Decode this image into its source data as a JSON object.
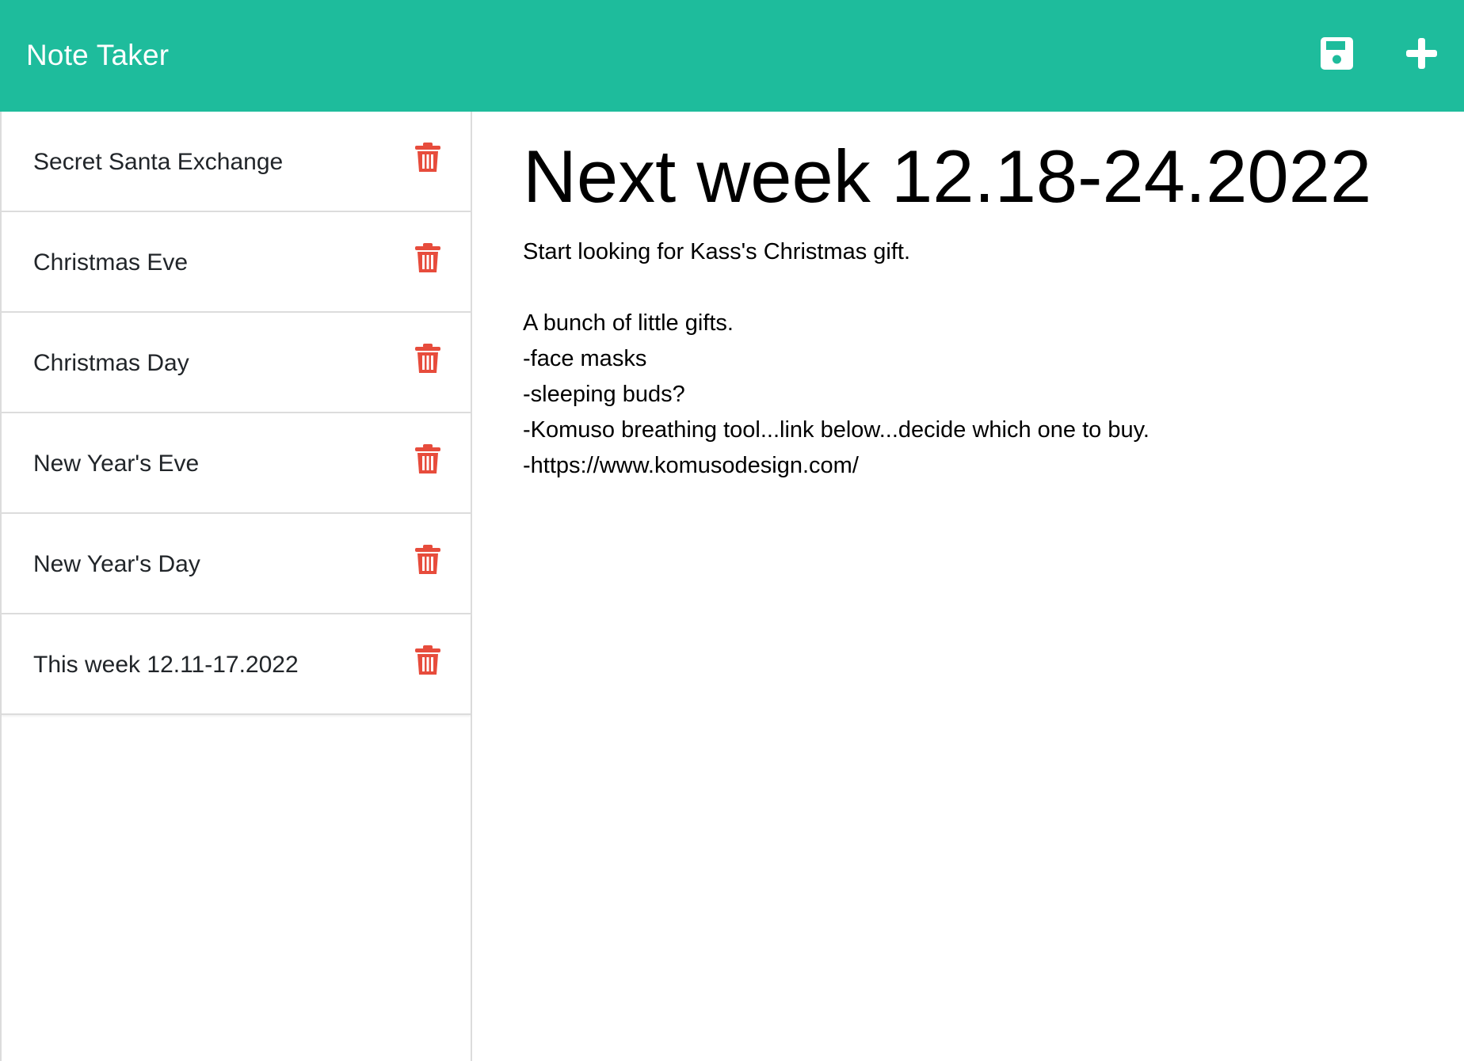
{
  "header": {
    "title": "Note Taker",
    "save_icon": "save-icon",
    "new_icon": "plus-icon"
  },
  "notes": [
    {
      "title": "Secret Santa Exchange",
      "delete_icon": "trash-icon"
    },
    {
      "title": "Christmas Eve",
      "delete_icon": "trash-icon"
    },
    {
      "title": "Christmas Day",
      "delete_icon": "trash-icon"
    },
    {
      "title": "New Year's Eve",
      "delete_icon": "trash-icon"
    },
    {
      "title": "New Year's Day",
      "delete_icon": "trash-icon"
    },
    {
      "title": "This week 12.11-17.2022",
      "delete_icon": "trash-icon"
    }
  ],
  "active_note": {
    "title": "Next week 12.18-24.2022",
    "body_lines": [
      "Start looking for Kass's Christmas gift.",
      "",
      "A bunch of little gifts.",
      "-face masks",
      "-sleeping buds?",
      "-Komuso breathing tool...link below...decide which one to buy.",
      "-https://www.komusodesign.com/"
    ]
  },
  "colors": {
    "navbar": "#1ebc9c",
    "delete_icon": "#e74c3c",
    "header_icons": "#ffffff"
  }
}
